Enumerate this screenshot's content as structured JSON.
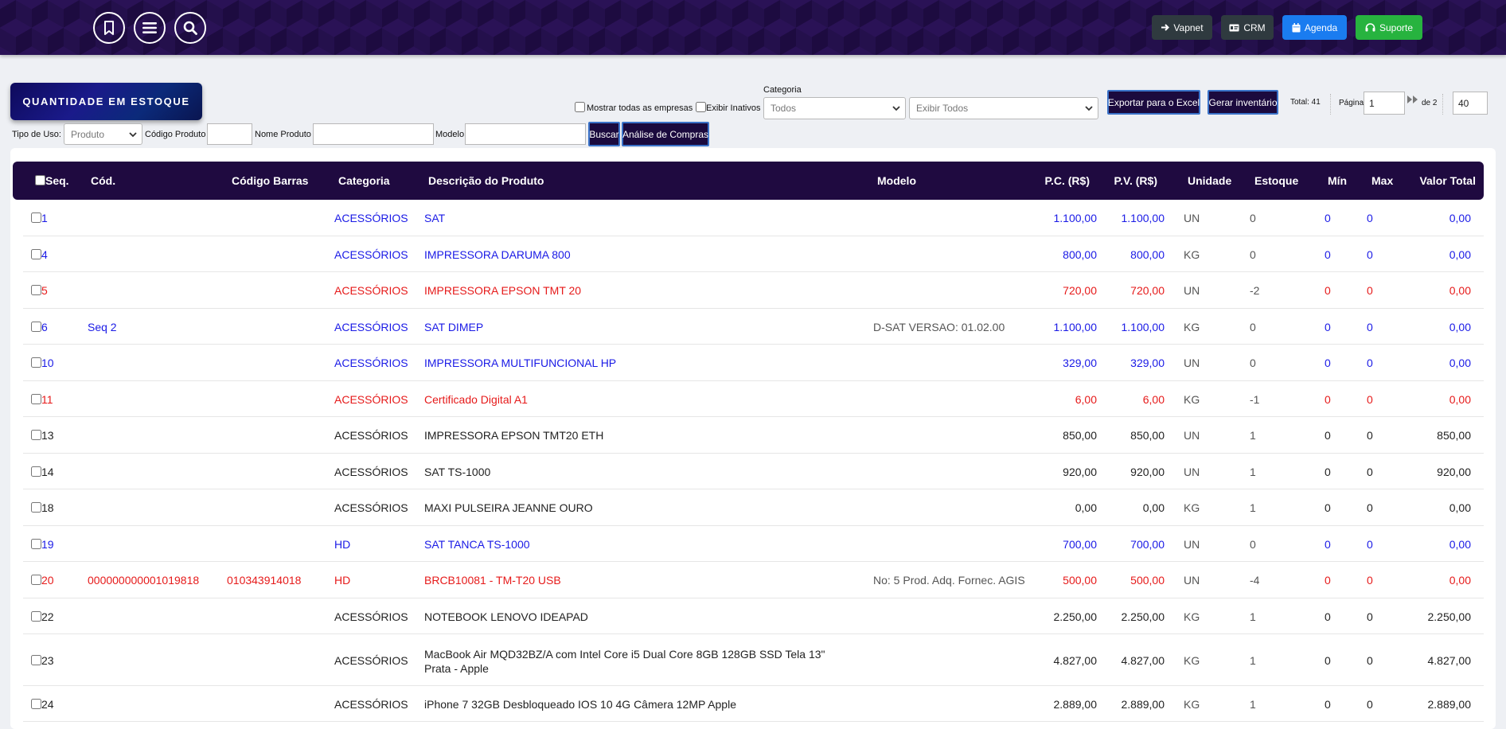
{
  "header": {
    "buttons": [
      {
        "label": "Vapnet",
        "icon": "arrow-right-icon",
        "color": "#2f3a3f"
      },
      {
        "label": "CRM",
        "icon": "id-card-icon",
        "color": "#2f3a3f"
      },
      {
        "label": "Agenda",
        "icon": "calendar-icon",
        "color": "#1a7cf0"
      },
      {
        "label": "Suporte",
        "icon": "headset-icon",
        "color": "#27b33f"
      }
    ]
  },
  "badge": "QUANTIDADE EM ESTOQUE",
  "filters": {
    "mostrar_todas": "Mostrar todas as empresas",
    "exibir_inativos": "Exibir Inativos",
    "categoria_label": "Categoria",
    "categoria_value": "Todos",
    "exibir_value": "Exibir Todos",
    "exportar": "Exportar para o Excel",
    "gerar": "Gerar inventário",
    "total": "Total: 41",
    "pagina_label": "Página",
    "pagina_value": "1",
    "de": "de 2",
    "per_page": "40",
    "tipo_uso_label": "Tipo de Uso:",
    "tipo_uso_value": "Produto",
    "codigo_label": "Código Produto",
    "nome_label": "Nome Produto",
    "modelo_label": "Modelo",
    "buscar": "Buscar",
    "analise": "Análise de Compras"
  },
  "table": {
    "columns": [
      "Seq.",
      "Cód.",
      "Código Barras",
      "Categoria",
      "Descrição do Produto",
      "Modelo",
      "P.C. (R$)",
      "P.V. (R$)",
      "Unidade",
      "Estoque",
      "Mín",
      "Max",
      "Valor Total"
    ],
    "colors": {
      "blue": "#1a1ae6",
      "red": "#e61a1a",
      "black": "#222222"
    },
    "rows": [
      {
        "seq": "1",
        "cod": "",
        "barras": "",
        "cat": "ACESSÓRIOS",
        "desc": "SAT",
        "desc2": "",
        "modelo": "",
        "pc": "1.100,00",
        "pv": "1.100,00",
        "un": "UN",
        "est": "0",
        "min": "0",
        "max": "0",
        "total": "0,00",
        "color": "blue"
      },
      {
        "seq": "4",
        "cod": "",
        "barras": "",
        "cat": "ACESSÓRIOS",
        "desc": "IMPRESSORA DARUMA 800",
        "desc2": "",
        "modelo": "",
        "pc": "800,00",
        "pv": "800,00",
        "un": "KG",
        "est": "0",
        "min": "0",
        "max": "0",
        "total": "0,00",
        "color": "blue"
      },
      {
        "seq": "5",
        "cod": "",
        "barras": "",
        "cat": "ACESSÓRIOS",
        "desc": "IMPRESSORA EPSON TMT 20",
        "desc2": "",
        "modelo": "",
        "pc": "720,00",
        "pv": "720,00",
        "un": "UN",
        "est": "-2",
        "min": "0",
        "max": "0",
        "total": "0,00",
        "color": "red"
      },
      {
        "seq": "6",
        "cod": "Seq 2",
        "barras": "",
        "cat": "ACESSÓRIOS",
        "desc": "SAT DIMEP",
        "desc2": "",
        "modelo": "D-SAT VERSAO: 01.02.00",
        "pc": "1.100,00",
        "pv": "1.100,00",
        "un": "KG",
        "est": "0",
        "min": "0",
        "max": "0",
        "total": "0,00",
        "color": "blue"
      },
      {
        "seq": "10",
        "cod": "",
        "barras": "",
        "cat": "ACESSÓRIOS",
        "desc": "IMPRESSORA MULTIFUNCIONAL HP",
        "desc2": "",
        "modelo": "",
        "pc": "329,00",
        "pv": "329,00",
        "un": "UN",
        "est": "0",
        "min": "0",
        "max": "0",
        "total": "0,00",
        "color": "blue"
      },
      {
        "seq": "11",
        "cod": "",
        "barras": "",
        "cat": "ACESSÓRIOS",
        "desc": "Certificado Digital A1",
        "desc2": "",
        "modelo": "",
        "pc": "6,00",
        "pv": "6,00",
        "un": "KG",
        "est": "-1",
        "min": "0",
        "max": "0",
        "total": "0,00",
        "color": "red"
      },
      {
        "seq": "13",
        "cod": "",
        "barras": "",
        "cat": "ACESSÓRIOS",
        "desc": "IMPRESSORA EPSON TMT20 ETH",
        "desc2": "",
        "modelo": "",
        "pc": "850,00",
        "pv": "850,00",
        "un": "UN",
        "est": "1",
        "min": "0",
        "max": "0",
        "total": "850,00",
        "color": "black"
      },
      {
        "seq": "14",
        "cod": "",
        "barras": "",
        "cat": "ACESSÓRIOS",
        "desc": "SAT TS-1000",
        "desc2": "",
        "modelo": "",
        "pc": "920,00",
        "pv": "920,00",
        "un": "UN",
        "est": "1",
        "min": "0",
        "max": "0",
        "total": "920,00",
        "color": "black"
      },
      {
        "seq": "18",
        "cod": "",
        "barras": "",
        "cat": "ACESSÓRIOS",
        "desc": "MAXI PULSEIRA JEANNE OURO",
        "desc2": "",
        "modelo": "",
        "pc": "0,00",
        "pv": "0,00",
        "un": "KG",
        "est": "1",
        "min": "0",
        "max": "0",
        "total": "0,00",
        "color": "black"
      },
      {
        "seq": "19",
        "cod": "",
        "barras": "",
        "cat": "HD",
        "desc": "SAT TANCA TS-1000",
        "desc2": "",
        "modelo": "",
        "pc": "700,00",
        "pv": "700,00",
        "un": "UN",
        "est": "0",
        "min": "0",
        "max": "0",
        "total": "0,00",
        "color": "blue"
      },
      {
        "seq": "20",
        "cod": "000000000001019818",
        "barras": "010343914018",
        "cat": "HD",
        "desc": "BRCB10081 - TM-T20 USB",
        "desc2": "",
        "modelo": "No: 5 Prod. Adq. Fornec. AGIS",
        "pc": "500,00",
        "pv": "500,00",
        "un": "UN",
        "est": "-4",
        "min": "0",
        "max": "0",
        "total": "0,00",
        "color": "red"
      },
      {
        "seq": "22",
        "cod": "",
        "barras": "",
        "cat": "ACESSÓRIOS",
        "desc": "NOTEBOOK LENOVO IDEAPAD",
        "desc2": "",
        "modelo": "",
        "pc": "2.250,00",
        "pv": "2.250,00",
        "un": "KG",
        "est": "1",
        "min": "0",
        "max": "0",
        "total": "2.250,00",
        "color": "black"
      },
      {
        "seq": "23",
        "cod": "",
        "barras": "",
        "cat": "ACESSÓRIOS",
        "desc": "MacBook Air MQD32BZ/A com Intel Core i5 Dual Core 8GB 128GB SSD Tela 13\"",
        "desc2": "Prata - Apple",
        "modelo": "",
        "pc": "4.827,00",
        "pv": "4.827,00",
        "un": "KG",
        "est": "1",
        "min": "0",
        "max": "0",
        "total": "4.827,00",
        "color": "black"
      },
      {
        "seq": "24",
        "cod": "",
        "barras": "",
        "cat": "ACESSÓRIOS",
        "desc": "iPhone 7 32GB Desbloqueado IOS 10 4G Câmera 12MP Apple",
        "desc2": "",
        "modelo": "",
        "pc": "2.889,00",
        "pv": "2.889,00",
        "un": "KG",
        "est": "1",
        "min": "0",
        "max": "0",
        "total": "2.889,00",
        "color": "black"
      }
    ]
  }
}
